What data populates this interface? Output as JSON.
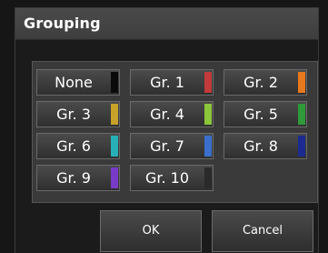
{
  "dialog": {
    "title": "Grouping",
    "groups": [
      {
        "label": "None",
        "color": "#0a0a0a"
      },
      {
        "label": "Gr. 1",
        "color": "#c23a3a"
      },
      {
        "label": "Gr. 2",
        "color": "#e8781e"
      },
      {
        "label": "Gr. 3",
        "color": "#c9a22a"
      },
      {
        "label": "Gr. 4",
        "color": "#8cc63a"
      },
      {
        "label": "Gr. 5",
        "color": "#2f9a3a"
      },
      {
        "label": "Gr. 6",
        "color": "#27b0b8"
      },
      {
        "label": "Gr. 7",
        "color": "#3a6fcc"
      },
      {
        "label": "Gr. 8",
        "color": "#1c2b8f"
      },
      {
        "label": "Gr. 9",
        "color": "#7a3ac8"
      },
      {
        "label": "Gr. 10",
        "color": "#2a2a2a"
      }
    ],
    "ok_label": "OK",
    "cancel_label": "Cancel"
  }
}
